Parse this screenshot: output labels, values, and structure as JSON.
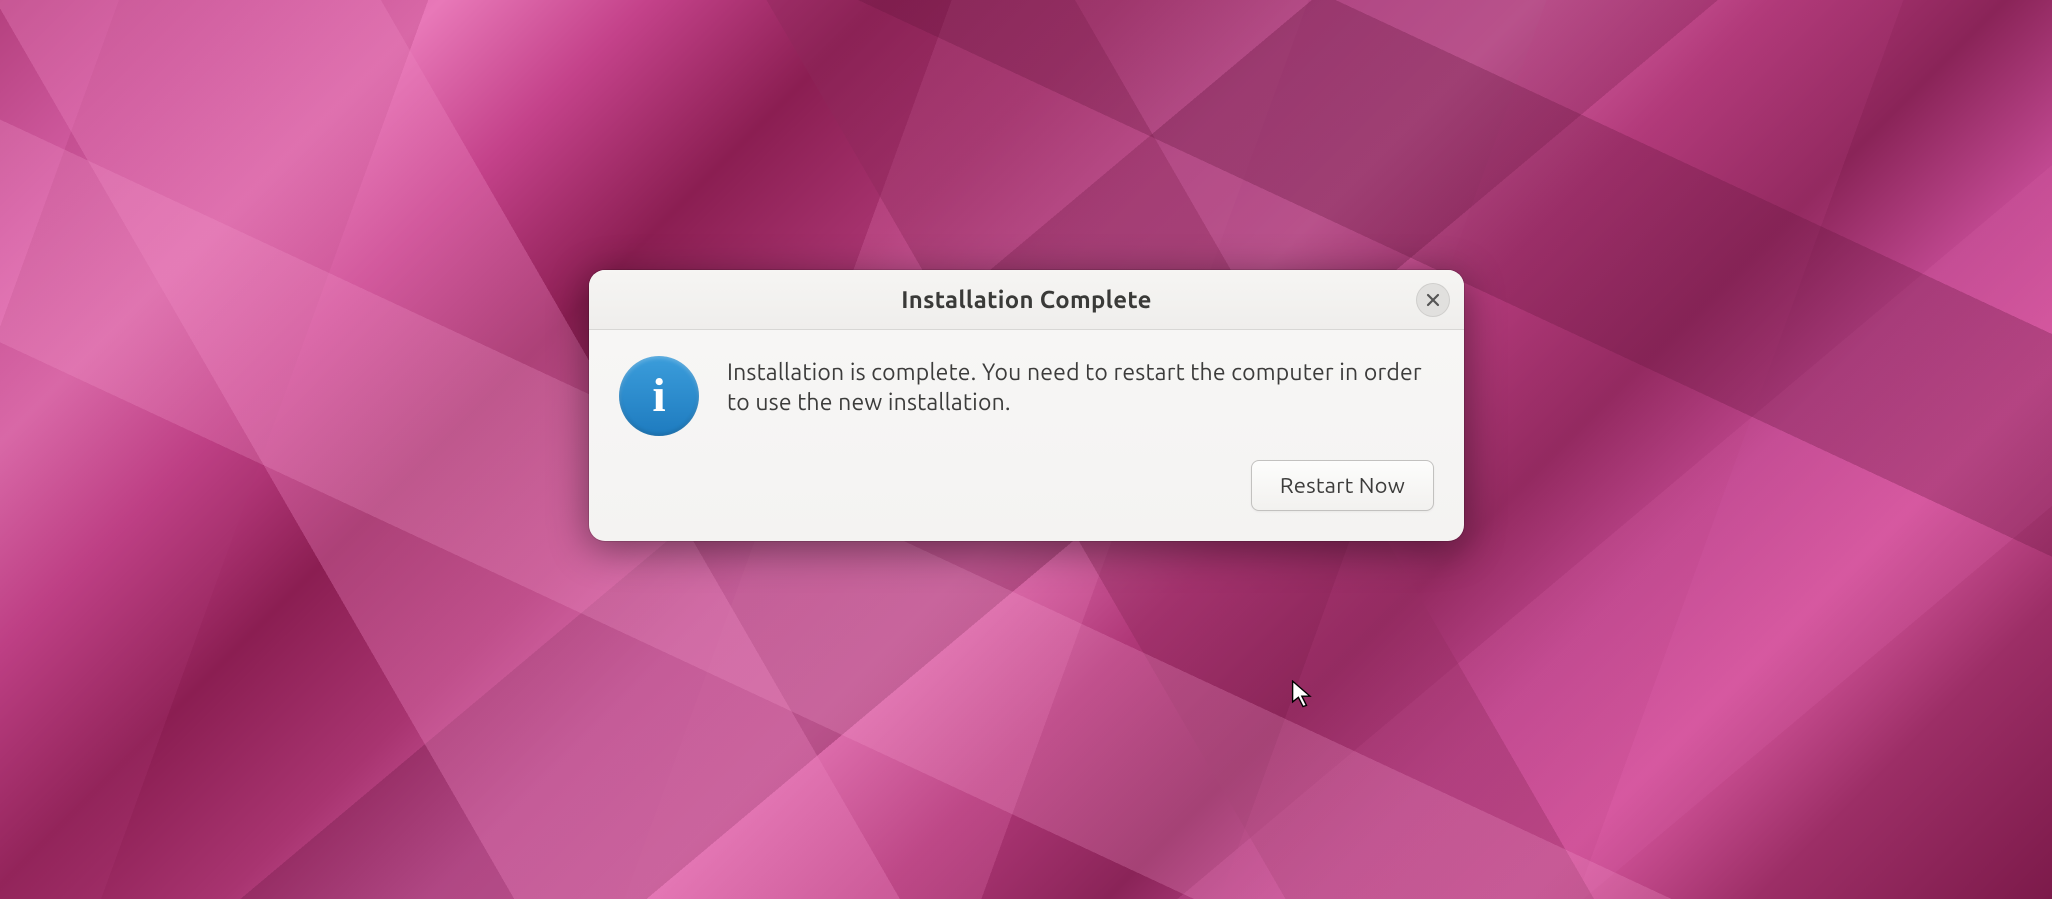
{
  "dialog": {
    "title": "Installation Complete",
    "message": "Installation is complete. You need to restart the computer in order to use the new installation.",
    "icon": "info-icon",
    "close_label": "Close",
    "actions": {
      "restart_label": "Restart Now"
    }
  }
}
